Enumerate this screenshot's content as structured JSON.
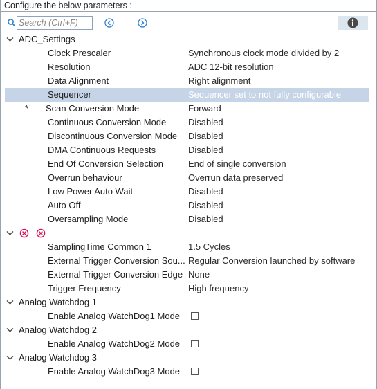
{
  "header": {
    "title": "Configure the below parameters :"
  },
  "toolbar": {
    "search_placeholder": "Search (Ctrl+F)"
  },
  "groups": [
    {
      "label": "ADC_Settings",
      "params": [
        {
          "name": "Clock Prescaler",
          "value": "Synchronous clock mode divided by 2"
        },
        {
          "name": "Resolution",
          "value": "ADC 12-bit resolution"
        },
        {
          "name": "Data Alignment",
          "value": "Right alignment"
        },
        {
          "name": "Sequencer",
          "value": "Sequencer set to not fully configurable",
          "selected": true
        },
        {
          "name": "Scan Conversion Mode",
          "value": "Forward",
          "marker": "*"
        },
        {
          "name": "Continuous Conversion Mode",
          "value": "Disabled"
        },
        {
          "name": "Discontinuous Conversion Mode",
          "value": "Disabled"
        },
        {
          "name": "DMA Continuous Requests",
          "value": "Disabled"
        },
        {
          "name": "End Of Conversion Selection",
          "value": "End of single conversion"
        },
        {
          "name": "Overrun behaviour",
          "value": "Overrun data preserved"
        },
        {
          "name": "Low Power Auto Wait",
          "value": "Disabled"
        },
        {
          "name": "Auto Off",
          "value": "Disabled"
        },
        {
          "name": "Oversampling Mode",
          "value": "Disabled"
        }
      ]
    },
    {
      "label": "",
      "params": [
        {
          "name": "SamplingTime Common 1",
          "value": "1.5 Cycles"
        },
        {
          "name": "External Trigger Conversion Sou...",
          "value": "Regular Conversion launched by software"
        },
        {
          "name": "External Trigger Conversion Edge",
          "value": "None"
        },
        {
          "name": "Trigger Frequency",
          "value": "High frequency"
        }
      ]
    },
    {
      "label": "Analog Watchdog 1",
      "params": [
        {
          "name": "Enable Analog WatchDog1 Mode",
          "checked": false
        }
      ]
    },
    {
      "label": "Analog Watchdog 2",
      "params": [
        {
          "name": "Enable Analog WatchDog2 Mode",
          "checked": false
        }
      ]
    },
    {
      "label": "Analog Watchdog 3",
      "params": [
        {
          "name": "Enable Analog WatchDog3 Mode",
          "checked": false
        }
      ]
    }
  ],
  "colors": {
    "selection": "#c5d4e6",
    "error": "#d4145a",
    "nav": "#2f7fd1"
  }
}
